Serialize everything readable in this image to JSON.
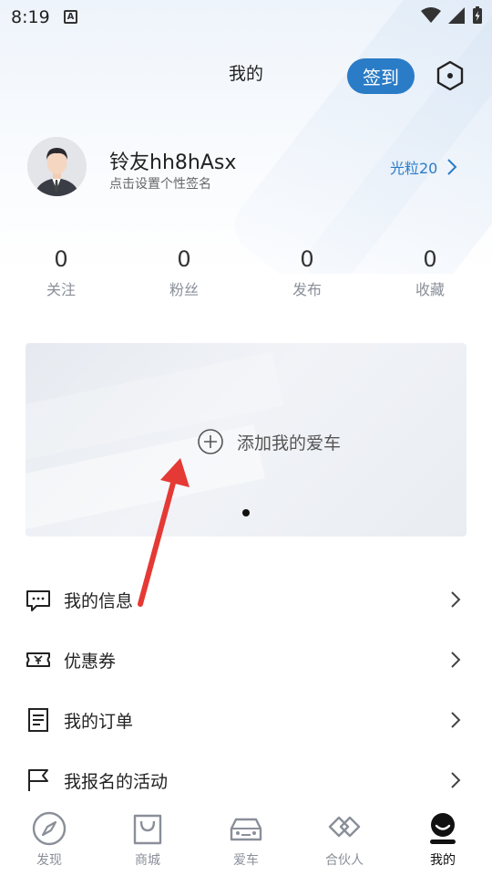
{
  "status_bar": {
    "time": "8:19",
    "app_indicator": "A"
  },
  "header": {
    "title": "我的",
    "signin_label": "签到"
  },
  "profile": {
    "username": "铃友hh8hAsx",
    "signature": "点击设置个性签名",
    "points_label": "光粒20"
  },
  "stats": [
    {
      "value": "0",
      "label": "关注"
    },
    {
      "value": "0",
      "label": "粉丝"
    },
    {
      "value": "0",
      "label": "发布"
    },
    {
      "value": "0",
      "label": "收藏"
    }
  ],
  "car_card": {
    "add_label": "添加我的爱车"
  },
  "menu": [
    {
      "label": "我的信息",
      "icon": "message-icon"
    },
    {
      "label": "优惠券",
      "icon": "coupon-icon"
    },
    {
      "label": "我的订单",
      "icon": "order-icon"
    },
    {
      "label": "我报名的活动",
      "icon": "flag-icon"
    }
  ],
  "bottom_nav": [
    {
      "label": "发现",
      "icon": "compass-icon",
      "active": false
    },
    {
      "label": "商城",
      "icon": "shopping-bag-icon",
      "active": false
    },
    {
      "label": "爱车",
      "icon": "car-icon",
      "active": false
    },
    {
      "label": "合伙人",
      "icon": "partner-icon",
      "active": false
    },
    {
      "label": "我的",
      "icon": "profile-icon",
      "active": true
    }
  ],
  "colors": {
    "accent": "#2a7cc7",
    "annotation_arrow": "#e53935"
  }
}
